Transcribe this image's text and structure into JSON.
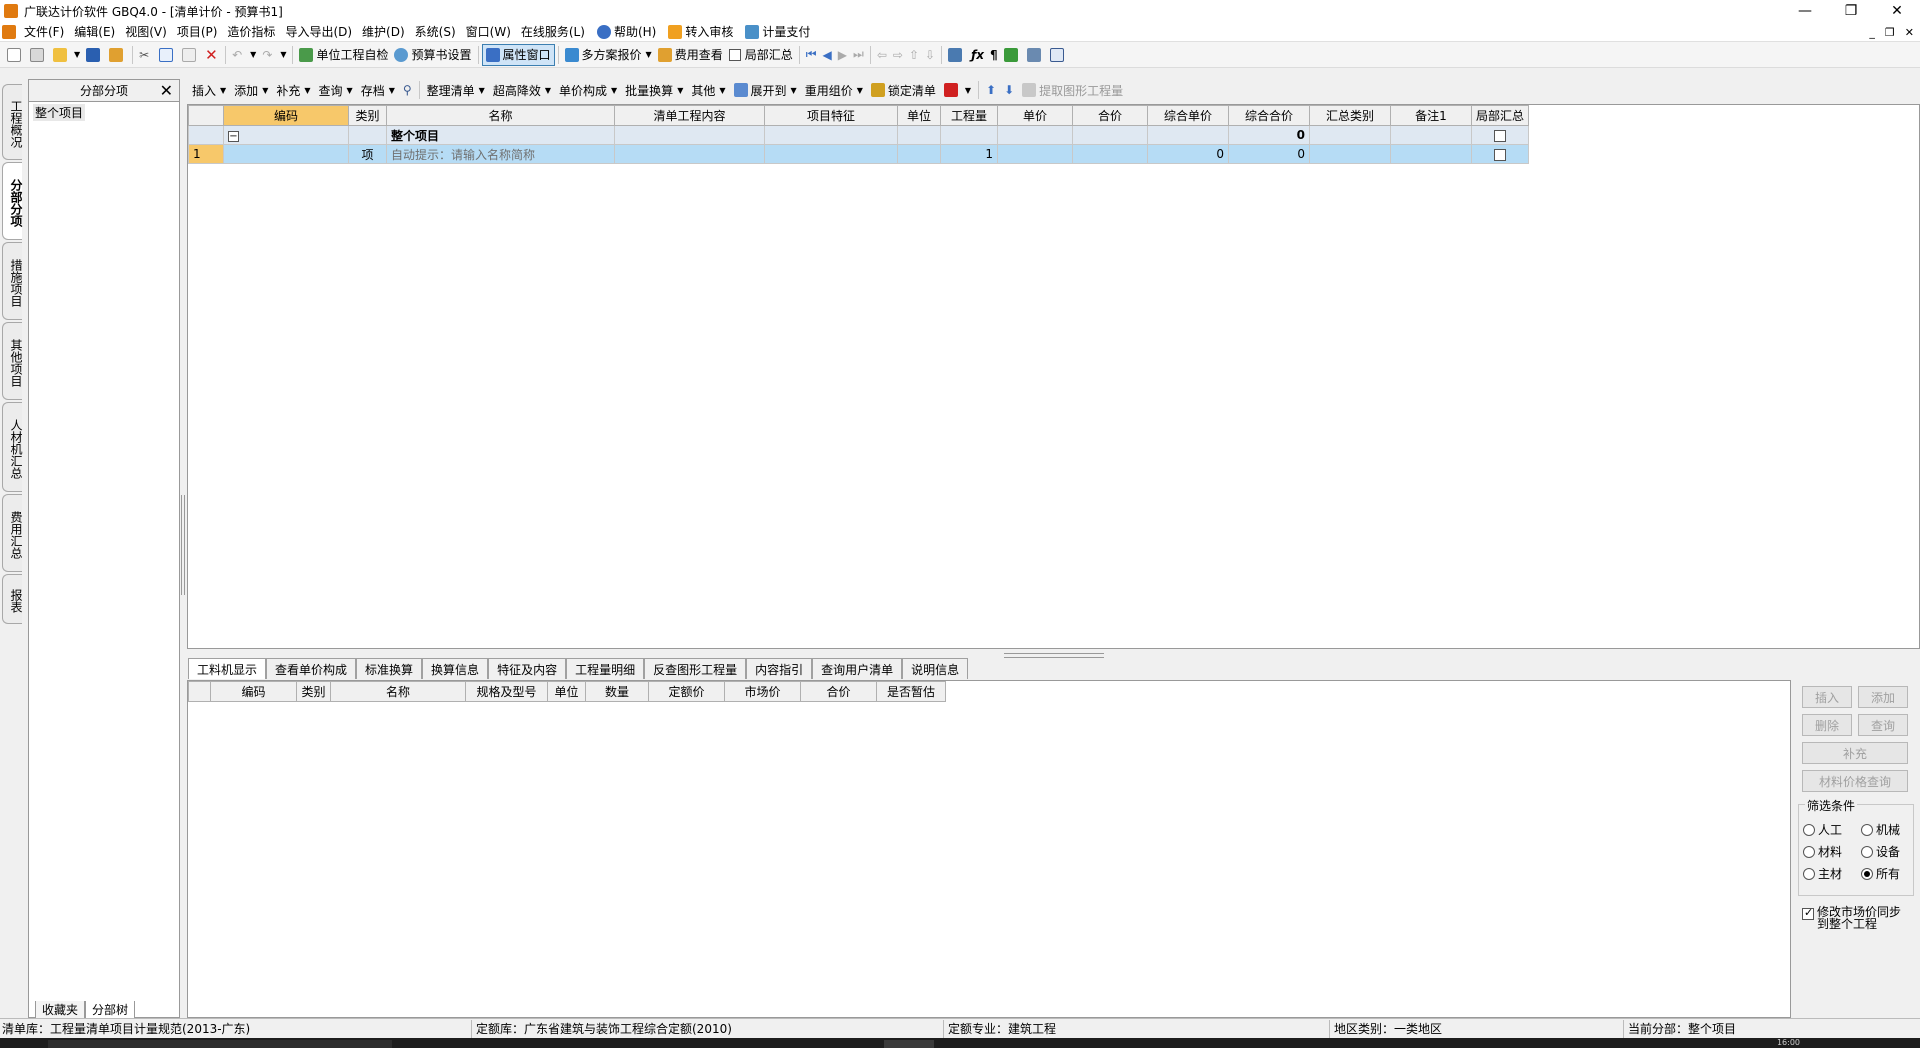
{
  "window": {
    "title": "广联达计价软件 GBQ4.0 - [清单计价 - 预算书1]"
  },
  "menu": [
    "文件(F)",
    "编辑(E)",
    "视图(V)",
    "项目(P)",
    "造价指标",
    "导入导出(D)",
    "维护(D)",
    "系统(S)",
    "窗口(W)",
    "在线服务(L)",
    "帮助(H)",
    "转入审核",
    "计量支付"
  ],
  "toolbar1": {
    "self_check": "单位工程自检",
    "budget_settings": "预算书设置",
    "property_window": "属性窗口",
    "multi_quote": "多方案报价",
    "fee_view": "费用查看",
    "partial_summary": "局部汇总"
  },
  "toolbar2": {
    "insert": "插入",
    "add": "添加",
    "supplement": "补充",
    "query": "查询",
    "archive": "存档",
    "organize": "整理清单",
    "over_height": "超高降效",
    "unit_price": "单价构成",
    "batch_convert": "批量换算",
    "other": "其他",
    "expand": "展开到",
    "reuse": "重用组价",
    "lock": "锁定清单",
    "extract": "提取图形工程量"
  },
  "sidebar_tabs": [
    "工程概况",
    "分部分项",
    "措施项目",
    "其他项目",
    "人材机汇总",
    "费用汇总",
    "报表"
  ],
  "left_panel": {
    "title": "分部分项",
    "tree_item": "整个项目",
    "tabs": [
      "收藏夹",
      "分部树"
    ]
  },
  "grid": {
    "headers": [
      "编码",
      "类别",
      "名称",
      "清单工程内容",
      "项目特征",
      "单位",
      "工程量",
      "单价",
      "合价",
      "综合单价",
      "综合合价",
      "汇总类别",
      "备注1",
      "局部汇总"
    ],
    "summary_row": {
      "expander": "−",
      "name": "整个项目",
      "total": "0"
    },
    "row1": {
      "index": "1",
      "type": "项",
      "name": "自动提示：请输入名称简称",
      "qty": "1",
      "unit_price": "0",
      "total": "0"
    }
  },
  "bottom_tabs": [
    "工料机显示",
    "查看单价构成",
    "标准换算",
    "换算信息",
    "特征及内容",
    "工程量明细",
    "反查图形工程量",
    "内容指引",
    "查询用户清单",
    "说明信息"
  ],
  "bottom_grid": {
    "headers": [
      "编码",
      "类别",
      "名称",
      "规格及型号",
      "单位",
      "数量",
      "定额价",
      "市场价",
      "合价",
      "是否暂估"
    ]
  },
  "right_panel": {
    "insert": "插入",
    "add": "添加",
    "delete": "删除",
    "query": "查询",
    "supplement": "补充",
    "price_query": "材料价格查询",
    "filter_title": "筛选条件",
    "filters": [
      "人工",
      "机械",
      "材料",
      "设备",
      "主材",
      "所有"
    ],
    "sync_text_line1": "修改市场价同步",
    "sync_text_line2": "到整个工程"
  },
  "status": {
    "list_lib": "清单库：工程量清单项目计量规范(2013-广东)",
    "quota_lib": "定额库：广东省建筑与装饰工程综合定额(2010)",
    "quota_major": "定额专业：建筑工程",
    "region": "地区类别：一类地区",
    "current_section": "当前分部：整个项目"
  },
  "taskbar": {
    "clock": "16:00"
  }
}
